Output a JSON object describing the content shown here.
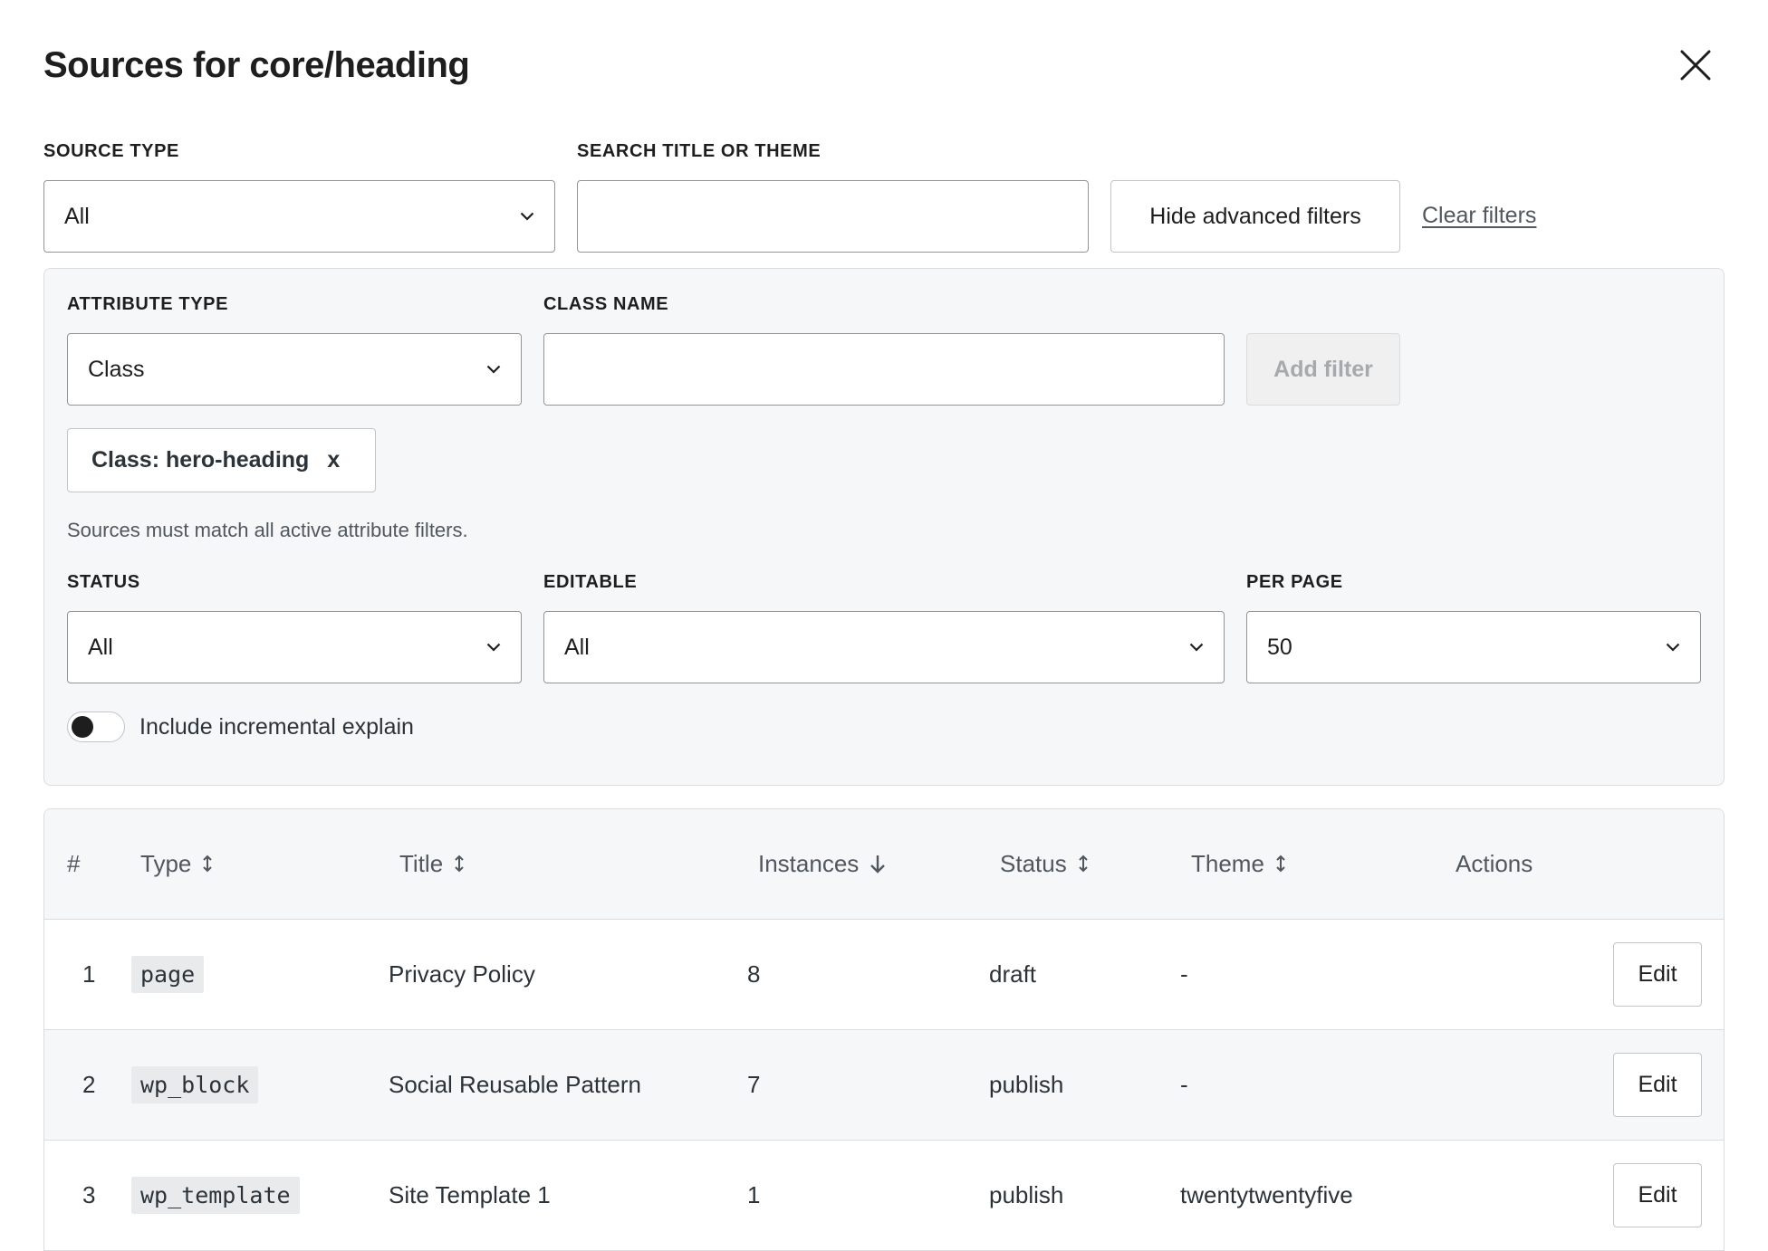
{
  "dialog": {
    "title": "Sources for core/heading",
    "close_icon": "close-icon"
  },
  "filters": {
    "source_type_label": "SOURCE TYPE",
    "source_type_value": "All",
    "search_label": "SEARCH TITLE OR THEME",
    "search_value": "",
    "search_placeholder": "",
    "toggle_advanced_label": "Hide advanced filters",
    "clear_label": "Clear filters"
  },
  "advanced": {
    "attribute_type_label": "ATTRIBUTE TYPE",
    "attribute_type_value": "Class",
    "class_name_label": "CLASS NAME",
    "class_name_value": "",
    "add_filter_label": "Add filter",
    "active_chip_label": "Class: hero-heading",
    "active_chip_remove": "x",
    "helper_text": "Sources must match all active attribute filters.",
    "status_label": "STATUS",
    "status_value": "All",
    "editable_label": "EDITABLE",
    "editable_value": "All",
    "per_page_label": "PER PAGE",
    "per_page_value": "50",
    "incremental_toggle_label": "Include incremental explain",
    "incremental_toggle_on": false
  },
  "table": {
    "columns": {
      "index": "#",
      "type": "Type",
      "title": "Title",
      "instances": "Instances",
      "status": "Status",
      "theme": "Theme",
      "actions": "Actions"
    },
    "sort": {
      "column": "instances",
      "direction": "desc"
    },
    "rows": [
      {
        "index": "1",
        "type": "page",
        "title": "Privacy Policy",
        "instances": "8",
        "status": "draft",
        "theme": "-",
        "action": "Edit"
      },
      {
        "index": "2",
        "type": "wp_block",
        "title": "Social Reusable Pattern",
        "instances": "7",
        "status": "publish",
        "theme": "-",
        "action": "Edit"
      },
      {
        "index": "3",
        "type": "wp_template",
        "title": "Site Template 1",
        "instances": "1",
        "status": "publish",
        "theme": "twentytwentyfive",
        "action": "Edit"
      }
    ]
  }
}
